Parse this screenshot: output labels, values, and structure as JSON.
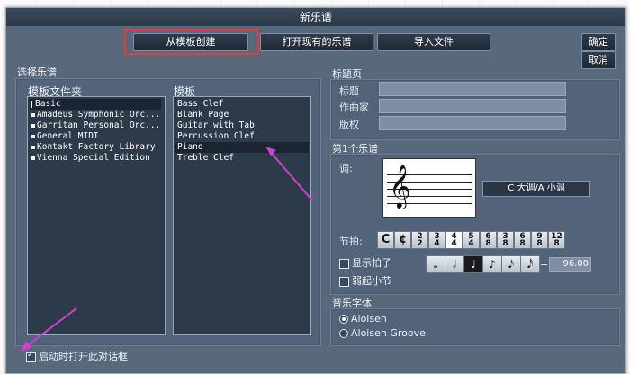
{
  "dialog": {
    "title": "新乐谱"
  },
  "top_buttons": {
    "create_from_template": "从模板创建",
    "open_existing": "打开现有的乐谱",
    "import_file": "导入文件",
    "ok": "确定",
    "cancel": "取消"
  },
  "choose_score": {
    "label": "选择乐谱",
    "folder_header": "模板文件夹",
    "template_header": "模板",
    "folders": [
      "Basic",
      "Amadeus Symphonic Orc...",
      "Garritan Personal Orc...",
      "General MIDI",
      "Kontakt Factory Library",
      "Vienna Special Edition"
    ],
    "templates": [
      "Bass Clef",
      "Blank Page",
      "Guitar with Tab",
      "Percussion Clef",
      "Piano",
      "Treble Clef"
    ],
    "selected_template": "Piano"
  },
  "title_page": {
    "label": "标题页",
    "title_label": "标题",
    "composer_label": "作曲家",
    "copyright_label": "版权",
    "title_value": "",
    "composer_value": "",
    "copyright_value": ""
  },
  "first_staff": {
    "label": "第1个乐谱",
    "key_label": "调:",
    "key_value": "C 大调/A 小调",
    "meter_label": "节拍:",
    "time_signatures": [
      "C",
      "¢",
      "2/2",
      "3/4",
      "4/4",
      "5/4",
      "6/8",
      "3/8",
      "6/8",
      "9/8",
      "12/8"
    ],
    "selected_time_signature": "4/4",
    "show_beat_label": "显示拍子",
    "pickup_label": "弱起小节",
    "note_values": [
      "𝅝",
      "𝅗𝅥",
      "♩",
      "♪",
      "𝅘𝅥𝅯",
      "𝅘𝅥𝅰"
    ],
    "selected_note": "♩",
    "tempo_equals": "=",
    "tempo_value": "96.00"
  },
  "music_font": {
    "label": "音乐字体",
    "options": [
      "Aloisen",
      "Aloisen Groove"
    ],
    "selected": "Aloisen"
  },
  "footer": {
    "show_on_startup": "启动时打开此对话框"
  },
  "colors": {
    "dialog_bg": "#58697c",
    "highlight_red": "#e03c3c",
    "arrow_magenta": "#d33fd3"
  }
}
